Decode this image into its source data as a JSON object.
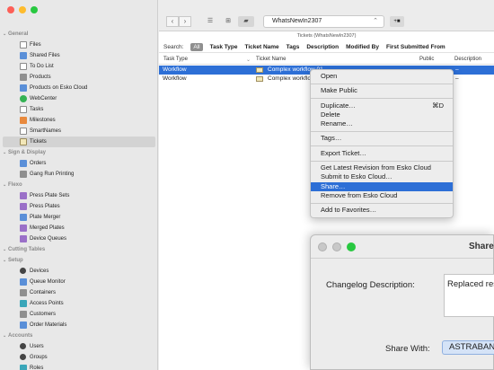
{
  "sidebar": {
    "sections": [
      {
        "title": "General",
        "items": [
          {
            "label": "Files",
            "icon": "document-icon"
          },
          {
            "label": "Shared Files",
            "icon": "shared-files-icon"
          },
          {
            "label": "To Do List",
            "icon": "todo-icon"
          },
          {
            "label": "Products",
            "icon": "products-icon"
          },
          {
            "label": "Products on Esko Cloud",
            "icon": "cloud-products-icon"
          },
          {
            "label": "WebCenter",
            "icon": "webcenter-icon"
          },
          {
            "label": "Tasks",
            "icon": "tasks-icon"
          },
          {
            "label": "Milestones",
            "icon": "milestones-icon"
          },
          {
            "label": "SmartNames",
            "icon": "smartnames-icon"
          },
          {
            "label": "Tickets",
            "icon": "ticket-icon",
            "selected": true
          }
        ]
      },
      {
        "title": "Sign & Display",
        "items": [
          {
            "label": "Orders",
            "icon": "orders-icon"
          },
          {
            "label": "Gang Run Printing",
            "icon": "gang-run-icon"
          }
        ]
      },
      {
        "title": "Flexo",
        "items": [
          {
            "label": "Press Plate Sets",
            "icon": "plate-sets-icon"
          },
          {
            "label": "Press Plates",
            "icon": "press-plates-icon"
          },
          {
            "label": "Plate Merger",
            "icon": "plate-merger-icon"
          },
          {
            "label": "Merged Plates",
            "icon": "merged-plates-icon"
          },
          {
            "label": "Device Queues",
            "icon": "device-queues-icon"
          }
        ]
      },
      {
        "title": "Cutting Tables",
        "items": []
      },
      {
        "title": "Setup",
        "items": [
          {
            "label": "Devices",
            "icon": "devices-icon"
          },
          {
            "label": "Queue Monitor",
            "icon": "queue-monitor-icon"
          },
          {
            "label": "Containers",
            "icon": "containers-icon"
          },
          {
            "label": "Access Points",
            "icon": "access-points-icon"
          },
          {
            "label": "Customers",
            "icon": "customers-icon"
          },
          {
            "label": "Order Materials",
            "icon": "order-materials-icon"
          }
        ]
      },
      {
        "title": "Accounts",
        "items": [
          {
            "label": "Users",
            "icon": "users-icon"
          },
          {
            "label": "Groups",
            "icon": "groups-icon"
          },
          {
            "label": "Roles",
            "icon": "roles-icon"
          }
        ]
      }
    ]
  },
  "toolbar": {
    "back": "‹",
    "forward": "›",
    "database": "WhatsNewIn2307",
    "add_label": "+■"
  },
  "view_subtitle": "Tickets (WhatsNewIn2307)",
  "search": {
    "label": "Search:",
    "all": "All",
    "options": [
      "Task Type",
      "Ticket Name",
      "Tags",
      "Description",
      "Modified By",
      "First Submitted From"
    ]
  },
  "columns": {
    "task_type": "Task Type",
    "ticket_name": "Ticket Name",
    "public": "Public",
    "description": "Description"
  },
  "rows": [
    {
      "task_type": "Workflow",
      "ticket_name": "Complex workflow 01",
      "public": "–",
      "selected": true
    },
    {
      "task_type": "Workflow",
      "ticket_name": "Complex workflow 02",
      "public": "–",
      "selected": false
    }
  ],
  "context_menu": [
    {
      "label": "Open"
    },
    {
      "sep": true
    },
    {
      "label": "Make Public"
    },
    {
      "sep": true
    },
    {
      "label": "Duplicate…",
      "shortcut": "⌘D"
    },
    {
      "label": "Delete"
    },
    {
      "label": "Rename…"
    },
    {
      "sep": true
    },
    {
      "label": "Tags…"
    },
    {
      "sep": true
    },
    {
      "label": "Export Ticket…"
    },
    {
      "sep": true
    },
    {
      "label": "Get Latest Revision from Esko Cloud"
    },
    {
      "label": "Submit to Esko Cloud…"
    },
    {
      "label": "Share…",
      "highlighted": true
    },
    {
      "label": "Remove from Esko Cloud"
    },
    {
      "sep": true
    },
    {
      "label": "Add to Favorites…"
    }
  ],
  "share_dialog": {
    "title": "Share",
    "changelog_label": "Changelog Description:",
    "changelog_value": "Replaced resource",
    "share_with_label": "Share With:",
    "share_with_value": "ASTRABANK"
  }
}
